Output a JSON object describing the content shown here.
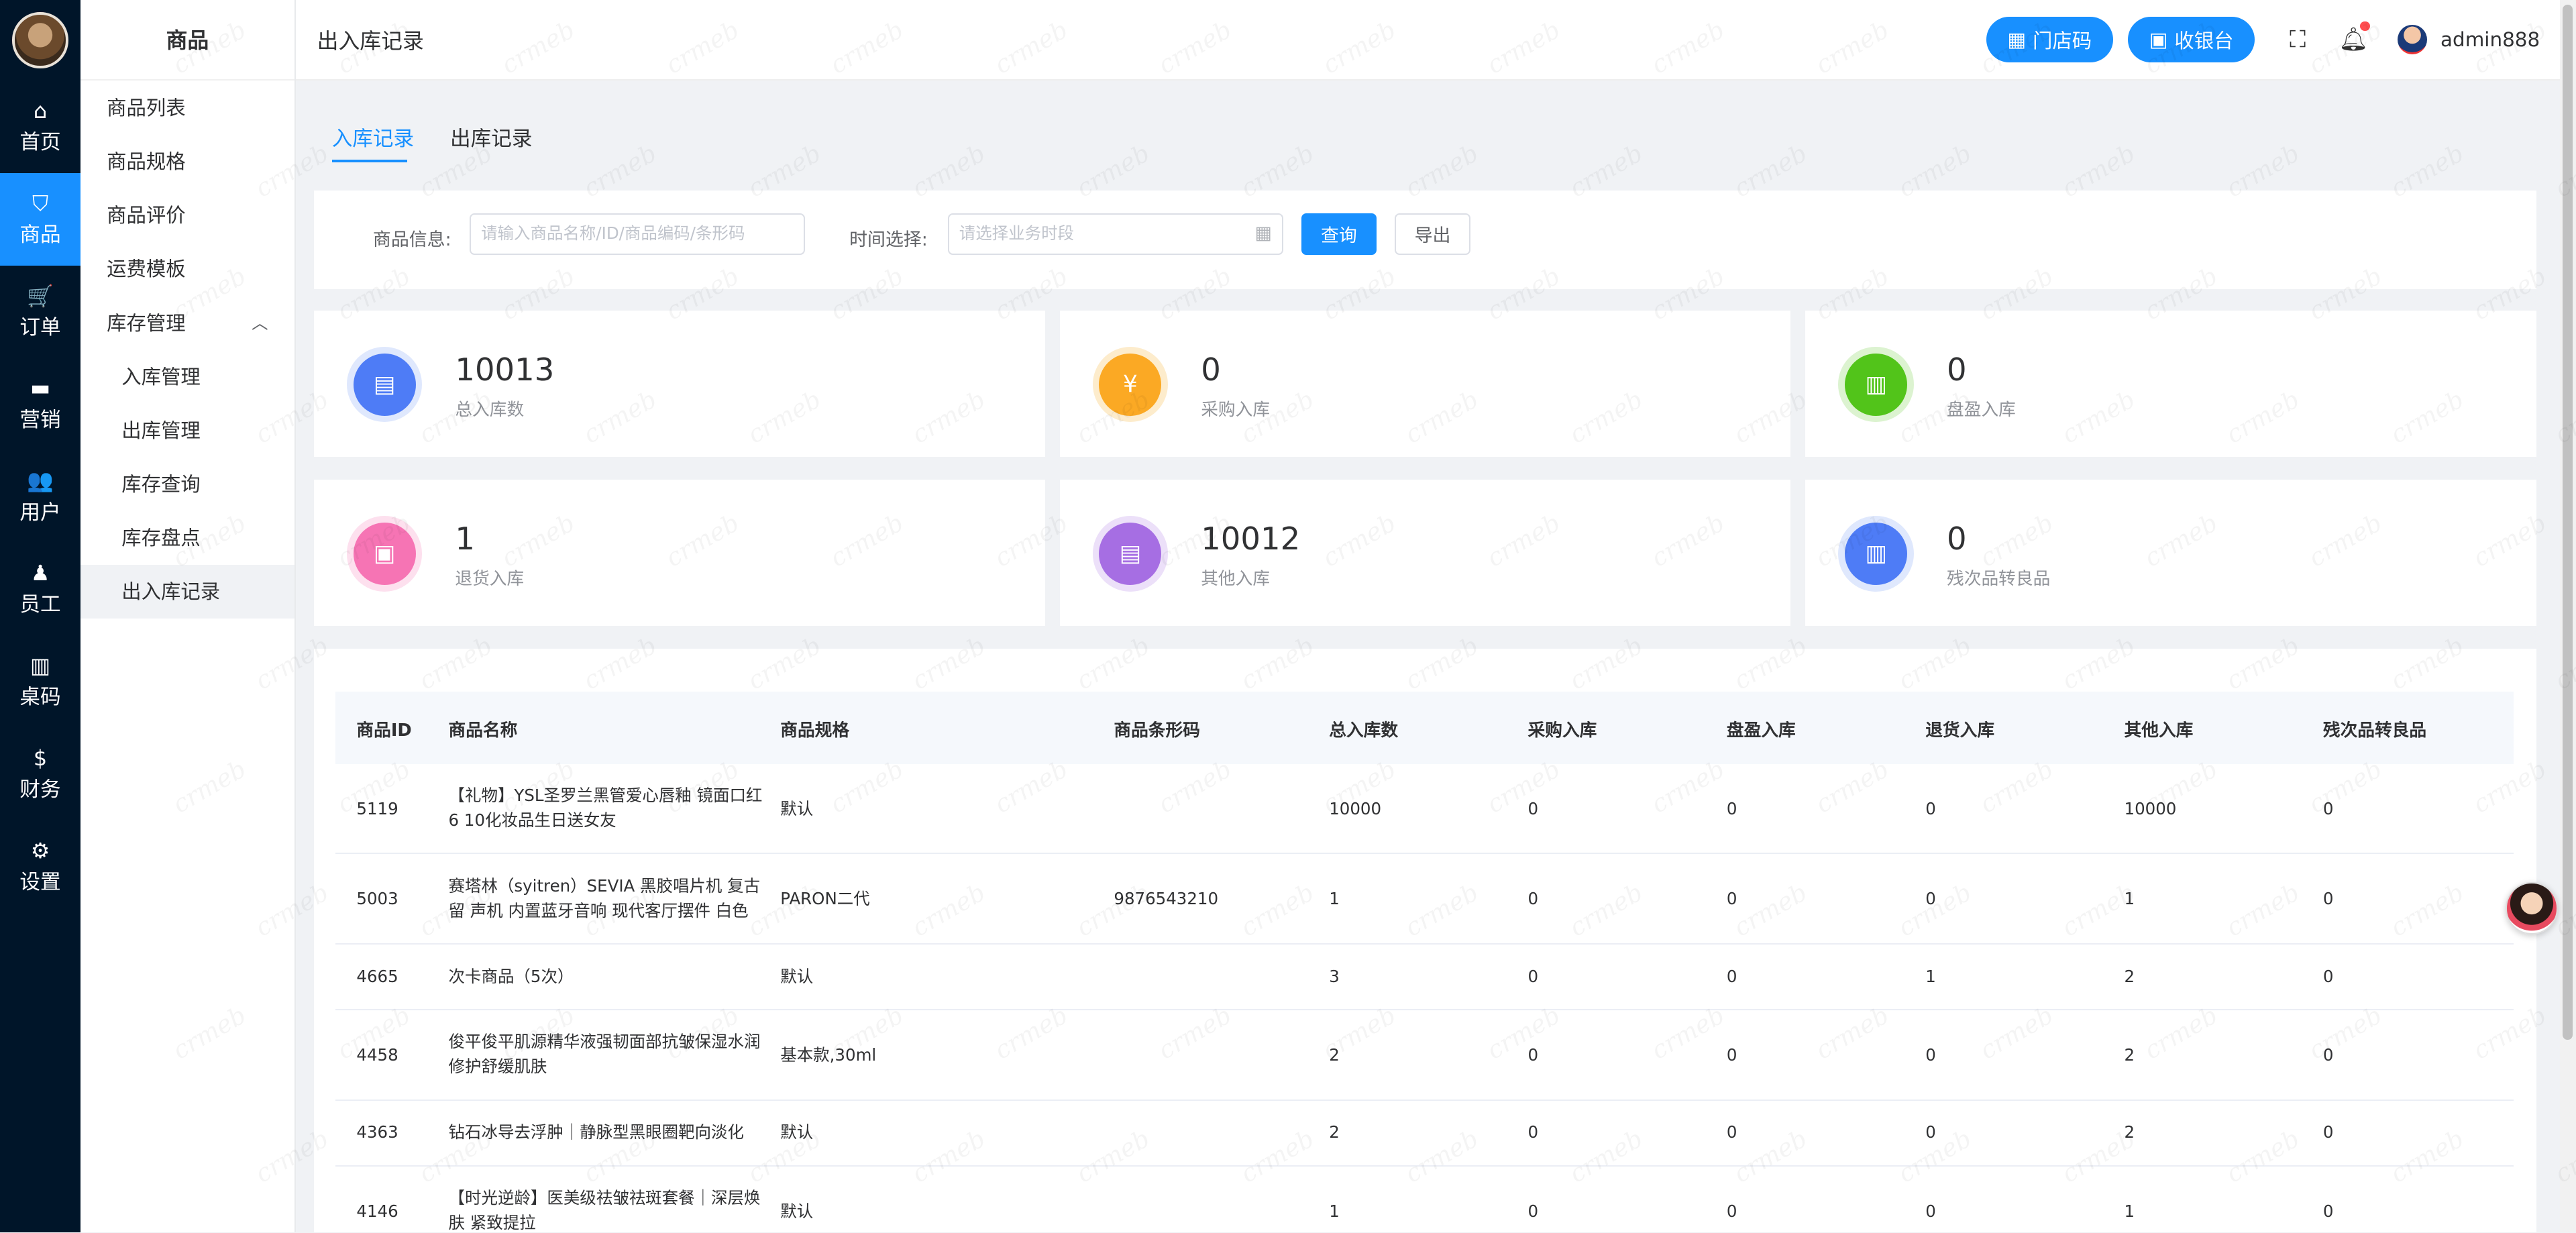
{
  "rail": {
    "items": [
      {
        "label": "首页",
        "icon": "home-icon",
        "glyph": "⌂"
      },
      {
        "label": "商品",
        "icon": "bag-icon",
        "glyph": "⛉"
      },
      {
        "label": "订单",
        "icon": "cart-icon",
        "glyph": "🛒"
      },
      {
        "label": "营销",
        "icon": "wallet-icon",
        "glyph": "▬"
      },
      {
        "label": "用户",
        "icon": "users-icon",
        "glyph": "👥"
      },
      {
        "label": "员工",
        "icon": "person-icon",
        "glyph": "♟"
      },
      {
        "label": "桌码",
        "icon": "map-icon",
        "glyph": "▥"
      },
      {
        "label": "财务",
        "icon": "dollar-icon",
        "glyph": "$"
      },
      {
        "label": "设置",
        "icon": "gear-icon",
        "glyph": "⚙"
      }
    ],
    "active_index": 1
  },
  "submenu": {
    "title": "商品",
    "items": [
      {
        "label": "商品列表"
      },
      {
        "label": "商品规格"
      },
      {
        "label": "商品评价"
      },
      {
        "label": "运费模板"
      },
      {
        "label": "库存管理"
      },
      {
        "label": "入库管理"
      },
      {
        "label": "出库管理"
      },
      {
        "label": "库存查询"
      },
      {
        "label": "库存盘点"
      },
      {
        "label": "出入库记录"
      }
    ],
    "chevron": "︿"
  },
  "header": {
    "title": "出入库记录",
    "store_code_label": "门店码",
    "cashier_label": "收银台",
    "username": "admin888",
    "accent": "#1890ff"
  },
  "tabs": {
    "inbound": "入库记录",
    "outbound": "出库记录"
  },
  "filter": {
    "product_label": "商品信息:",
    "product_placeholder": "请输入商品名称/ID/商品编码/条形码",
    "time_label": "时间选择:",
    "time_placeholder": "请选择业务时段",
    "query_label": "查询",
    "export_label": "导出"
  },
  "stats": [
    {
      "value": "10013",
      "caption": "总入库数",
      "color": "#4e7cf6",
      "ring": "#dfe8fd",
      "icon": "doc-icon"
    },
    {
      "value": "0",
      "caption": "采购入库",
      "color": "#fba924",
      "ring": "#fdeccc",
      "icon": "yen-icon"
    },
    {
      "value": "0",
      "caption": "盘盈入库",
      "color": "#52c41a",
      "ring": "#dcf3d0",
      "icon": "clipboard-icon"
    },
    {
      "value": "1",
      "caption": "退货入库",
      "color": "#f674b4",
      "ring": "#fde0ee",
      "icon": "box-icon"
    },
    {
      "value": "10012",
      "caption": "其他入库",
      "color": "#a66ee3",
      "ring": "#ece0f9",
      "icon": "doc-icon"
    },
    {
      "value": "0",
      "caption": "残次品转良品",
      "color": "#4e7cf6",
      "ring": "#dfe8fd",
      "icon": "clipboard-icon"
    }
  ],
  "table": {
    "headers": [
      "商品ID",
      "商品名称",
      "商品规格",
      "商品条形码",
      "总入库数",
      "采购入库",
      "盘盈入库",
      "退货入库",
      "其他入库",
      "残次品转良品"
    ],
    "rows": [
      [
        "5119",
        "【礼物】YSL圣罗兰黑管爱心唇釉 镜面口红6 10化妆品生日送女友",
        "默认",
        "",
        "10000",
        "0",
        "0",
        "0",
        "10000",
        "0"
      ],
      [
        "5003",
        "赛塔林（syitren）SEVIA 黑胶唱片机 复古留 声机 内置蓝牙音响 现代客厅摆件 白色",
        "PARON二代",
        "9876543210",
        "1",
        "0",
        "0",
        "0",
        "1",
        "0"
      ],
      [
        "4665",
        "次卡商品（5次）",
        "默认",
        "",
        "3",
        "0",
        "0",
        "1",
        "2",
        "0"
      ],
      [
        "4458",
        "俊平俊平肌源精华液强韧面部抗皱保湿水润 修护舒缓肌肤",
        "基本款,30ml",
        "",
        "2",
        "0",
        "0",
        "0",
        "2",
        "0"
      ],
      [
        "4363",
        "钻石冰导去浮肿｜静脉型黑眼圈靶向淡化",
        "默认",
        "",
        "2",
        "0",
        "0",
        "0",
        "2",
        "0"
      ],
      [
        "4146",
        "【时光逆龄】医美级祛皱祛斑套餐｜深层焕 肤 紧致提拉",
        "默认",
        "",
        "1",
        "0",
        "0",
        "0",
        "1",
        "0"
      ]
    ]
  },
  "watermark": "crmeb"
}
